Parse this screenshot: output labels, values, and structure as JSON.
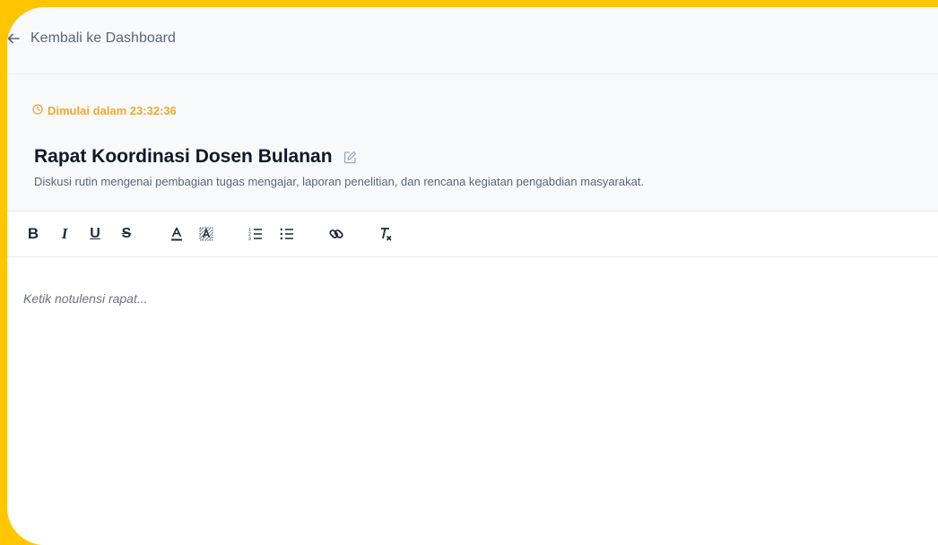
{
  "nav": {
    "back_label": "Kembali ke Dashboard"
  },
  "meeting": {
    "countdown": "Dimulai dalam 23:32:36",
    "title": "Rapat Koordinasi Dosen Bulanan",
    "description": "Diskusi rutin mengenai pembagian tugas mengajar, laporan penelitian, dan rencana kegiatan pengabdian masyarakat."
  },
  "toolbar": {
    "bold": "B",
    "italic": "I",
    "underline": "U",
    "strike": "S",
    "icons": [
      "bold-icon",
      "italic-icon",
      "underline-icon",
      "strikethrough-icon",
      "text-color-icon",
      "highlight-color-icon",
      "ordered-list-icon",
      "bullet-list-icon",
      "link-icon",
      "clear-format-icon"
    ]
  },
  "editor": {
    "placeholder": "Ketik notulensi rapat..."
  },
  "colors": {
    "background": "#FFC600",
    "accent": "#F0A82A",
    "text": "#111827",
    "muted": "#5B6578"
  }
}
